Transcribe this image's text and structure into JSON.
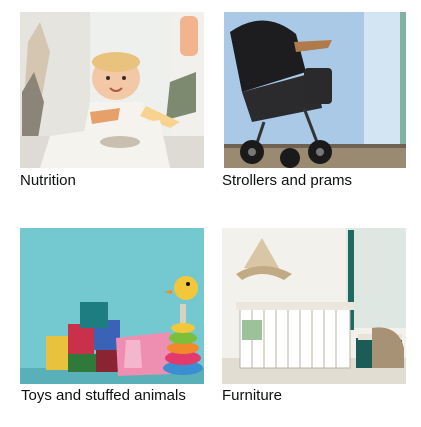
{
  "categories": [
    {
      "label": "Nutrition",
      "image": "baby-in-high-chair-photo"
    },
    {
      "label": "Strollers and prams",
      "image": "black-stroller-photo"
    },
    {
      "label": "Toys and stuffed animals",
      "image": "colorful-toy-blocks-photo"
    },
    {
      "label": "Furniture",
      "image": "nursery-crib-photo"
    }
  ]
}
